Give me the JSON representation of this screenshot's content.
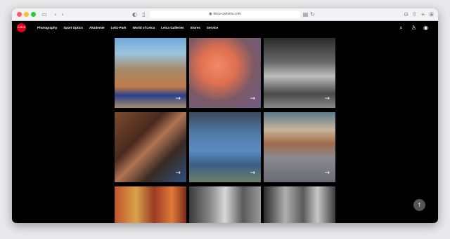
{
  "browser": {
    "url": "leica-camera.com",
    "icons": {
      "sidebar": "sidebar-icon",
      "back": "back-icon",
      "forward": "forward-icon",
      "privacy": "privacy-shield-icon",
      "lock": "lock-icon",
      "translate": "translate-icon",
      "reload": "reload-icon",
      "download": "download-icon",
      "share": "share-icon",
      "new_tab": "new-tab-icon",
      "tabs": "tab-overview-icon"
    }
  },
  "site": {
    "logo_text": "Leica",
    "brand_color": "#e2001a",
    "nav": [
      "Photography",
      "Sport Optics",
      "Akademie",
      "Leitz-Park",
      "World of Leica",
      "Leica Galleries",
      "Stores",
      "Service"
    ],
    "icons": {
      "search": "search-icon",
      "account": "user-icon",
      "location": "location-pin-icon"
    }
  },
  "gallery": {
    "arrow_glyph": "→",
    "tiles": [
      {
        "label": "beach-swimmer-photo",
        "has_arrow": true
      },
      {
        "label": "flamingo-car-photo",
        "has_arrow": true
      },
      {
        "label": "dogs-on-steps-photo",
        "has_arrow": true
      },
      {
        "label": "masked-embrace-photo",
        "has_arrow": true
      },
      {
        "label": "surgeons-operating-photo",
        "has_arrow": true
      },
      {
        "label": "children-in-yard-photo",
        "has_arrow": true
      },
      {
        "label": "colorful-crowd-photo",
        "has_arrow": false
      },
      {
        "label": "people-street-photo",
        "has_arrow": false
      },
      {
        "label": "man-with-mural-photo",
        "has_arrow": false
      }
    ]
  },
  "scroll_top_glyph": "↑"
}
